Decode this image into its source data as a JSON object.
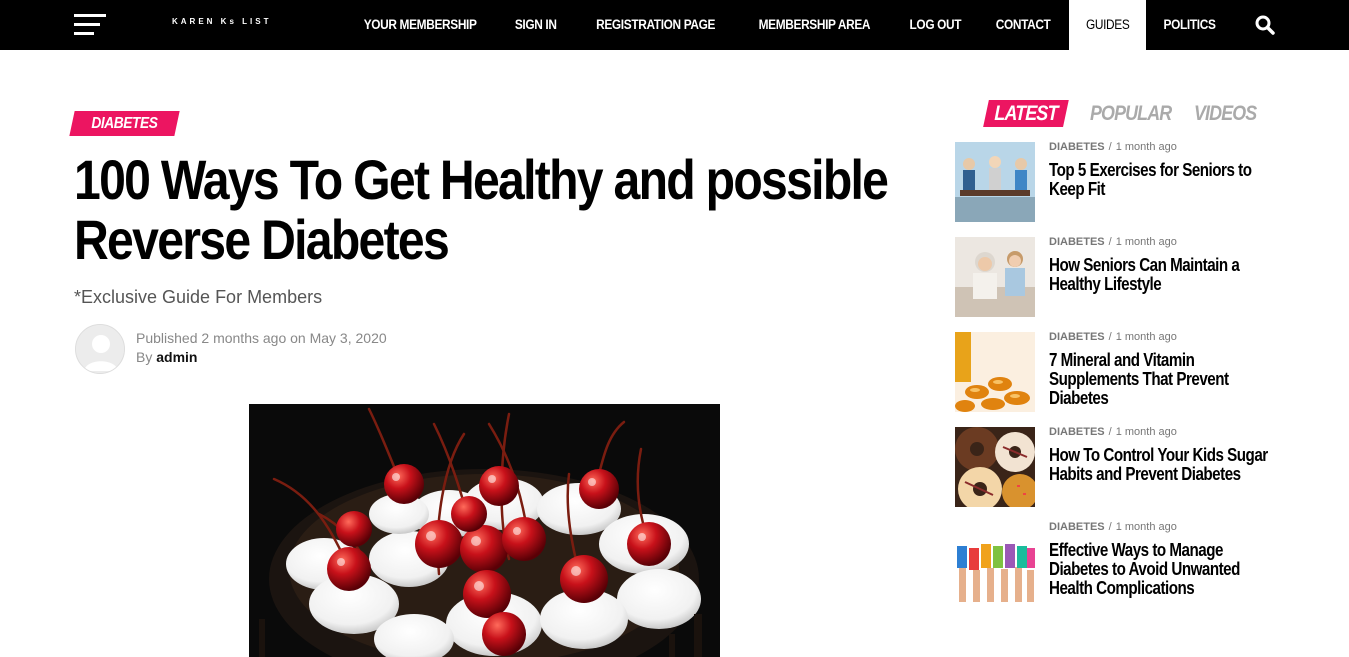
{
  "nav": {
    "logo": "KAREN Ks LIST",
    "items": [
      {
        "label": "YOUR MEMBERSHIP"
      },
      {
        "label": "SIGN IN"
      },
      {
        "label": "REGISTRATION PAGE"
      },
      {
        "label": "MEMBERSHIP AREA"
      },
      {
        "label": "LOG OUT"
      },
      {
        "label": "CONTACT"
      },
      {
        "label": "GUIDES",
        "active": true
      },
      {
        "label": "POLITICS"
      }
    ],
    "menu_icon": "hamburger-icon",
    "search_icon": "search-icon"
  },
  "article": {
    "category": "DIABETES",
    "title_line1": "100 Ways To Get Healthy and possible",
    "title_line2": "Reverse Diabetes",
    "subtitle": "*Exclusive Guide For Members",
    "published_prefix": "Published",
    "published_ago": "2 months ago",
    "published_on": "on May 3, 2020",
    "by_label": "By",
    "author": "admin"
  },
  "sidebar": {
    "tabs": [
      {
        "label": "LATEST",
        "active": true
      },
      {
        "label": "POPULAR"
      },
      {
        "label": "VIDEOS"
      }
    ],
    "items": [
      {
        "category": "DIABETES",
        "sep": "/",
        "ago": "1 month ago",
        "title": "Top 5 Exercises for Seniors to Keep Fit"
      },
      {
        "category": "DIABETES",
        "sep": "/",
        "ago": "1 month ago",
        "title": "How Seniors Can Maintain a Healthy Lifestyle"
      },
      {
        "category": "DIABETES",
        "sep": "/",
        "ago": "1 month ago",
        "title": "7 Mineral and Vitamin Supplements That Prevent Diabetes"
      },
      {
        "category": "DIABETES",
        "sep": "/",
        "ago": "1 month ago",
        "title": "How To Control Your Kids Sugar Habits and Prevent Diabetes"
      },
      {
        "category": "DIABETES",
        "sep": "/",
        "ago": "1 month ago",
        "title": "Effective Ways to Manage Diabetes to Avoid Unwanted Health Complications"
      }
    ]
  },
  "colors": {
    "accent": "#ec1561",
    "nav_bg": "#000000"
  }
}
